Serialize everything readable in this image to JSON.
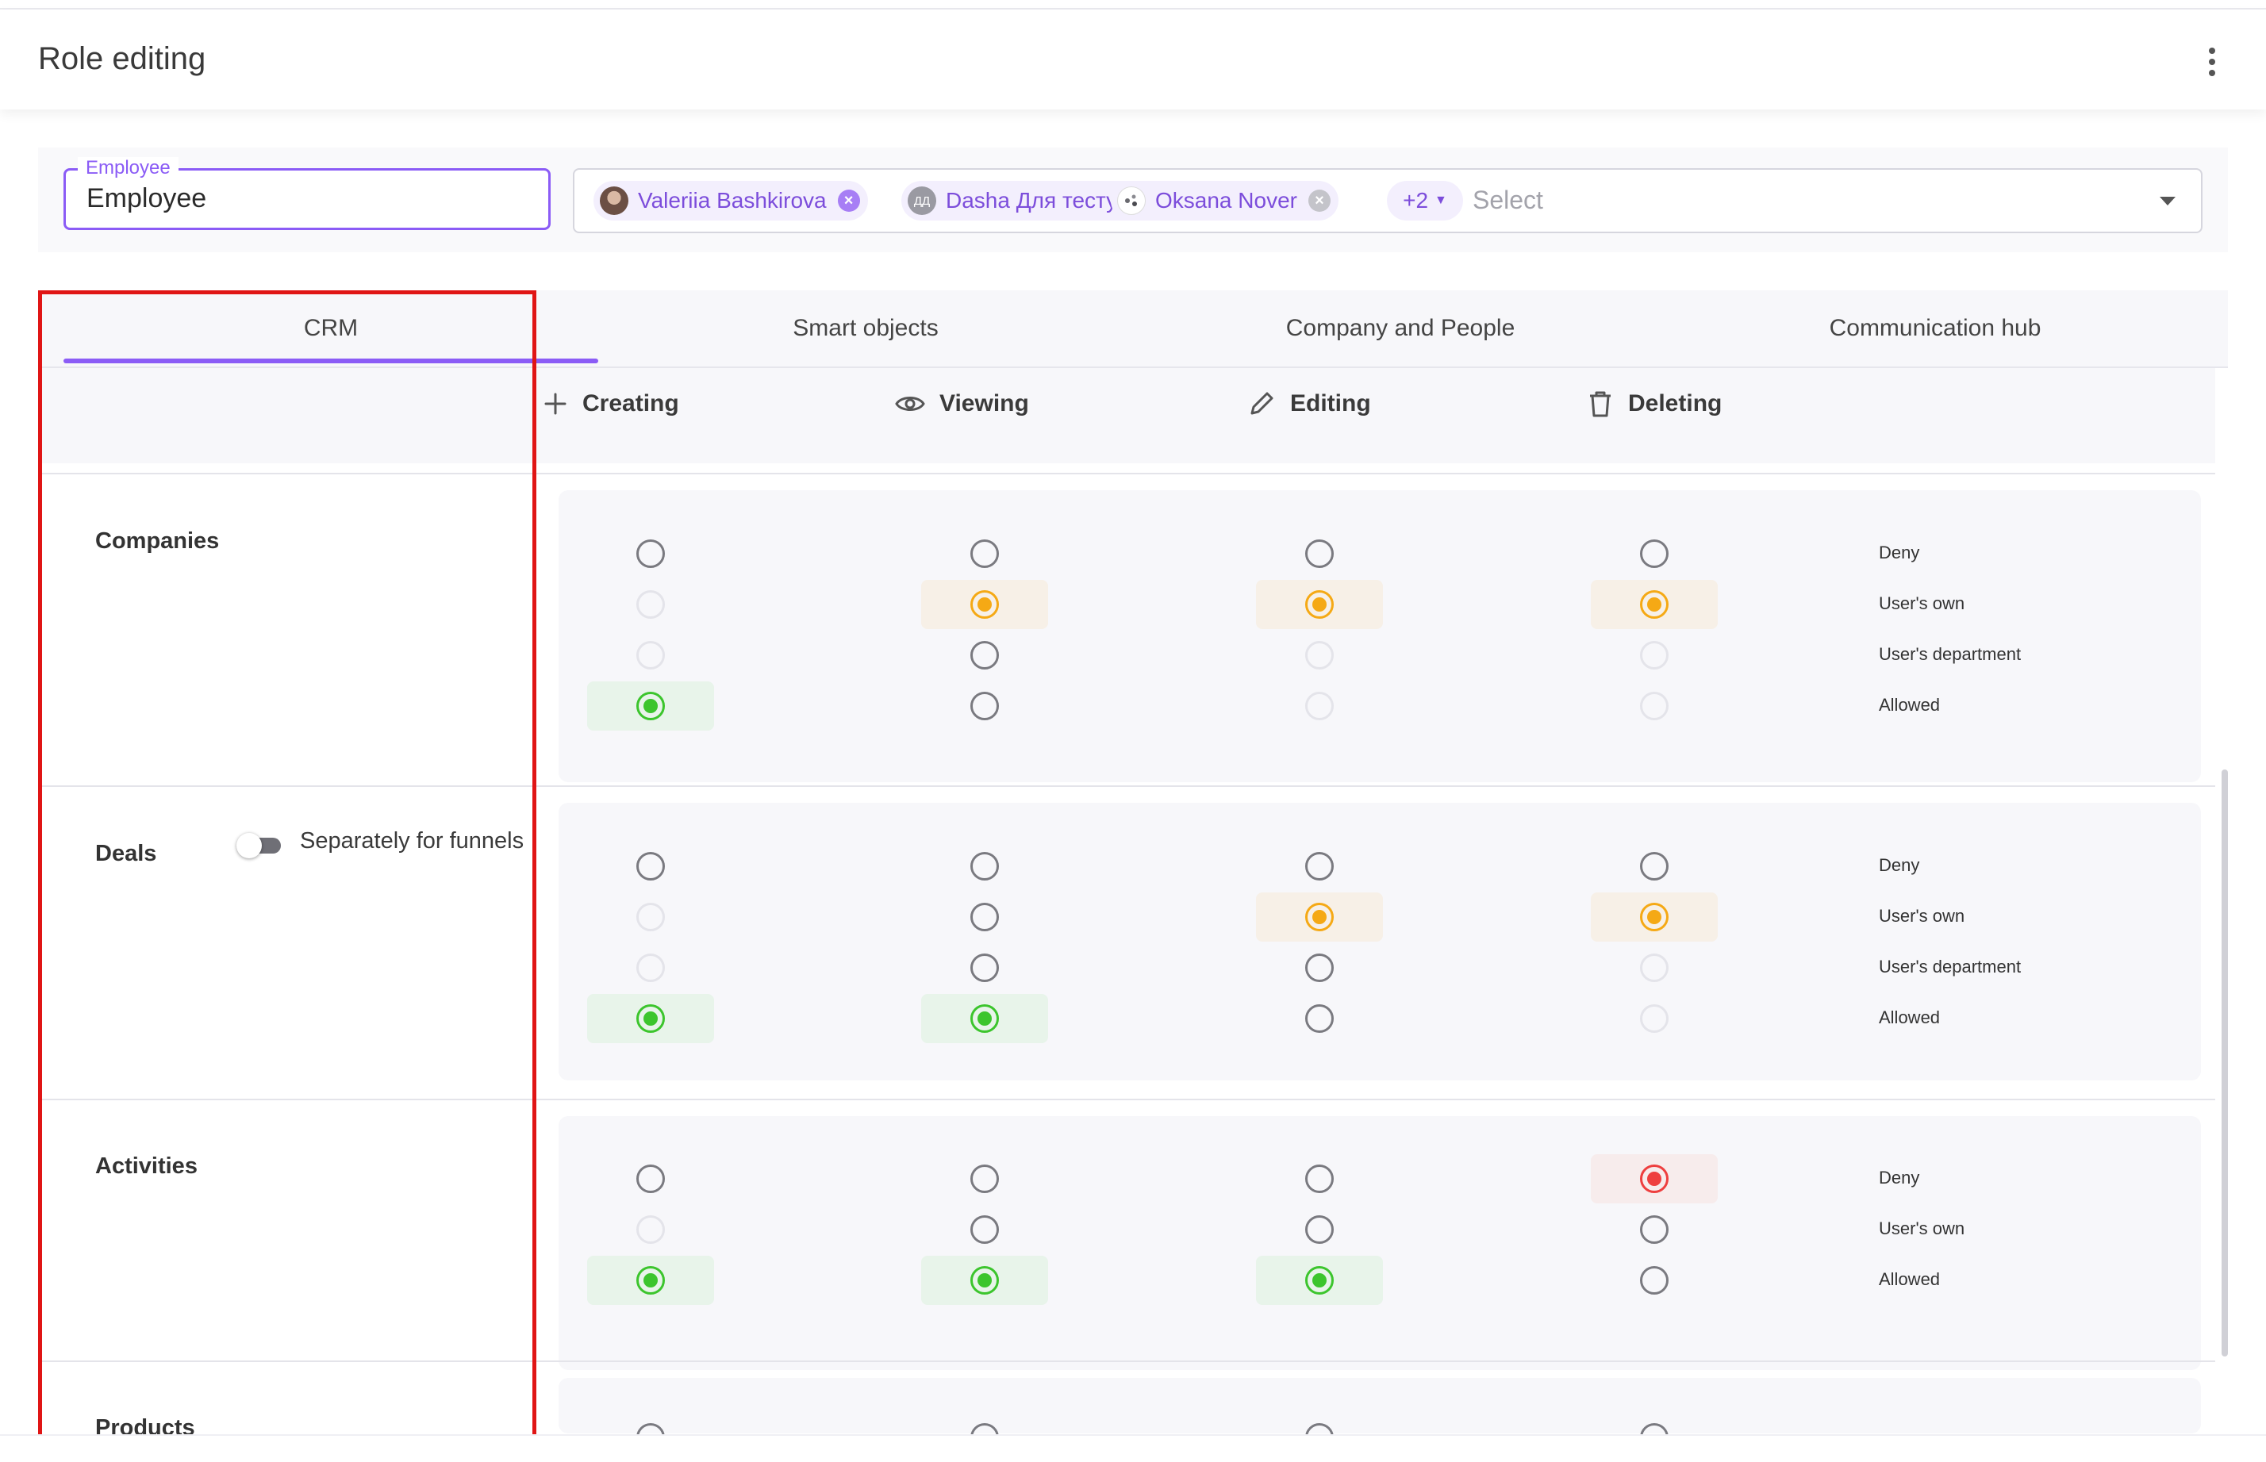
{
  "header": {
    "title": "Role editing",
    "menu_icon": "kebab-vertical-icon"
  },
  "role": {
    "name_label": "Employee",
    "name_value": "Employee",
    "users": [
      {
        "name": "Valeriia Bashkirova",
        "avatar": "photo",
        "avatar_color": "#8a7062"
      },
      {
        "name": "Dasha Для тесту",
        "avatar": "ДД",
        "avatar_color": "#9a9aa2"
      },
      {
        "name": "Oksana Nover",
        "avatar": "logo",
        "avatar_color": "#ffffff"
      }
    ],
    "more_count": "+2",
    "placeholder": "Select"
  },
  "tabs": [
    {
      "label": "CRM",
      "active": true
    },
    {
      "label": "Smart objects",
      "active": false
    },
    {
      "label": "Company and People",
      "active": false
    },
    {
      "label": "Communication hub",
      "active": false
    }
  ],
  "columns": [
    {
      "label": "Creating",
      "icon": "plus-icon"
    },
    {
      "label": "Viewing",
      "icon": "eye-icon"
    },
    {
      "label": "Editing",
      "icon": "pencil-icon"
    },
    {
      "label": "Deleting",
      "icon": "trash-icon"
    }
  ],
  "sections": [
    {
      "title": "Companies",
      "levels": [
        "Deny",
        "User's own",
        "User's department",
        "Allowed"
      ],
      "selected": [
        "Allowed",
        "User's own",
        "User's own",
        "User's own"
      ],
      "available": [
        [
          "Deny",
          "Allowed"
        ],
        [
          "Deny",
          "User's own",
          "User's department",
          "Allowed"
        ],
        [
          "Deny",
          "User's own"
        ],
        [
          "Deny",
          "User's own"
        ]
      ]
    },
    {
      "title": "Deals",
      "toggle_label": "Separately for funnels",
      "toggle_on": false,
      "levels": [
        "Deny",
        "User's own",
        "User's department",
        "Allowed"
      ],
      "selected": [
        "Allowed",
        "Allowed",
        "User's own",
        "User's own"
      ],
      "available": [
        [
          "Deny",
          "Allowed"
        ],
        [
          "Deny",
          "User's own",
          "User's department",
          "Allowed"
        ],
        [
          "Deny",
          "User's own",
          "User's department",
          "Allowed"
        ],
        [
          "Deny",
          "User's own"
        ]
      ]
    },
    {
      "title": "Activities",
      "levels": [
        "Deny",
        "User's own",
        "Allowed"
      ],
      "selected": [
        "Allowed",
        "Allowed",
        "Allowed",
        "Deny"
      ],
      "available": [
        [
          "Deny",
          "Allowed"
        ],
        [
          "Deny",
          "User's own",
          "Allowed"
        ],
        [
          "Deny",
          "User's own",
          "Allowed"
        ],
        [
          "Deny",
          "User's own",
          "Allowed"
        ]
      ]
    },
    {
      "title": "Products"
    }
  ],
  "colors": {
    "accent": "#8b5cf6",
    "allowed": "#3cc52d",
    "users_own": "#f5a915",
    "deny": "#ee3f3f",
    "highlight_box": "#e01515"
  }
}
